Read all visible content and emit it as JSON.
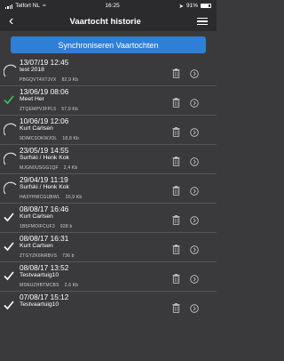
{
  "status_bar": {
    "carrier": "Telfort NL",
    "time": "16:25",
    "battery": "91%"
  },
  "nav": {
    "title": "Vaartocht historie"
  },
  "sync_button": "Synchroniseren Vaartochten",
  "trips": [
    {
      "date": "13/07/19 12:45",
      "name": "test 2018",
      "code": "PBGQVT4XTJVX",
      "size": "82,9 Kb",
      "status": "pending"
    },
    {
      "date": "13/06/19 08:06",
      "name": "Meet Her",
      "code": "ZTQEMPV3FPL5",
      "size": "57,9 Kb",
      "status": "synced-green"
    },
    {
      "date": "10/06/19 12:06",
      "name": "Kurt Carlsen",
      "code": "9DIMCSOKWJOL",
      "size": "18,8 Kb",
      "status": "pending"
    },
    {
      "date": "23/05/19 14:55",
      "name": "Surfski / Henk Kok",
      "code": "MJGN0USGG1QF",
      "size": "2,4 Kb",
      "status": "pending"
    },
    {
      "date": "29/04/19 11:19",
      "name": "Surfski / Henk Kok",
      "code": "HA3YHWCGUBWL",
      "size": "20,9 Kb",
      "status": "pending"
    },
    {
      "date": "08/08/17 16:46",
      "name": "Kurt Carlsen",
      "code": "1B5FMOIFCUF3",
      "size": "928 b",
      "status": "synced"
    },
    {
      "date": "08/08/17 16:31",
      "name": "Kurt Carlsen",
      "code": "ZTGYZK6NRBVS",
      "size": "736 b",
      "status": "synced"
    },
    {
      "date": "08/08/17 13:52",
      "name": "Testvaartuig10",
      "code": "MSNUZHBTMCBS",
      "size": "2,6 Kb",
      "status": "synced"
    },
    {
      "date": "07/08/17 15:12",
      "name": "Testvaartuig10",
      "code": "",
      "size": "",
      "status": "synced"
    }
  ],
  "colors": {
    "background": "#3a3a3c",
    "accent": "#2f7fd6",
    "check_green": "#34c759"
  }
}
